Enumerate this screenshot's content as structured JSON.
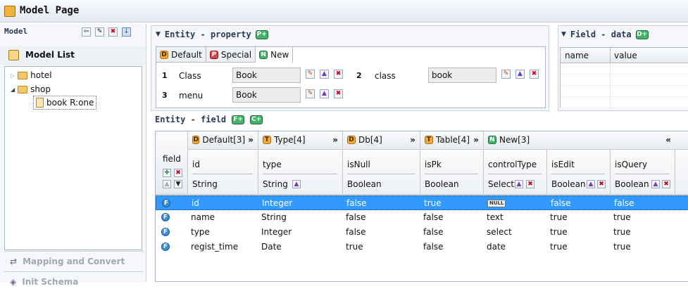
{
  "window": {
    "title": "Model Page"
  },
  "model_panel": {
    "title": "Model",
    "list_title": "Model List",
    "tree": [
      {
        "label": "hotel"
      },
      {
        "label": "shop"
      },
      {
        "label": "book R:one"
      }
    ],
    "bottom_items": [
      "Mapping and Convert",
      "Init Schema"
    ]
  },
  "entity_property": {
    "title": "Entity - property",
    "tabs": [
      "Default",
      "Special",
      "New"
    ],
    "fields": [
      {
        "num": "1",
        "label": "Class",
        "value": "Book"
      },
      {
        "num": "2",
        "label": "class",
        "value": "book"
      },
      {
        "num": "3",
        "label": "menu",
        "value": "Book"
      }
    ]
  },
  "field_data": {
    "title": "Field - data",
    "columns": [
      "name",
      "value"
    ]
  },
  "entity_field": {
    "title": "Entity - field",
    "field_label": "field",
    "groups": [
      "Default[3]",
      "Type[4]",
      "Db[4]",
      "Table[4]",
      "New[3]"
    ],
    "columns": [
      {
        "name": "id",
        "type": "String"
      },
      {
        "name": "type",
        "type": "String"
      },
      {
        "name": "isNull",
        "type": "Boolean"
      },
      {
        "name": "isPk",
        "type": "Boolean"
      },
      {
        "name": "controlType",
        "type": "Select"
      },
      {
        "name": "isEdit",
        "type": "Boolean"
      },
      {
        "name": "isQuery",
        "type": "Boolean"
      }
    ],
    "null_badge": "NULL",
    "rows": [
      [
        "id",
        "Integer",
        "false",
        "true",
        "",
        "false",
        "false"
      ],
      [
        "name",
        "String",
        "false",
        "false",
        "text",
        "true",
        "true"
      ],
      [
        "type",
        "Integer",
        "false",
        "false",
        "select",
        "true",
        "true"
      ],
      [
        "regist_time",
        "Date",
        "true",
        "false",
        "date",
        "true",
        "true"
      ]
    ]
  },
  "icons": {
    "fold": "«",
    "expand": "»"
  }
}
